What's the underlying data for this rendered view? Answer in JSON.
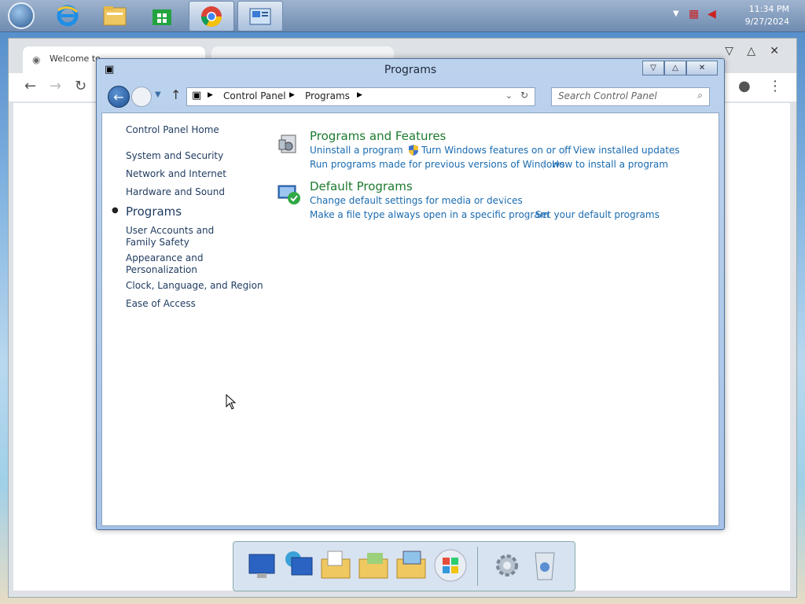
{
  "taskbar": {
    "clock_time": "11:34 PM",
    "clock_date": "9/27/2024",
    "apps": [
      "internet-explorer",
      "file-explorer",
      "windows-store",
      "chrome",
      "control-panel"
    ]
  },
  "chrome": {
    "tab1_title": "Welcome to"
  },
  "window": {
    "title": "Programs",
    "breadcrumb": [
      "Control Panel",
      "Programs"
    ],
    "search_placeholder": "Search Control Panel"
  },
  "left_nav": {
    "home": "Control Panel Home",
    "items": [
      "System and Security",
      "Network and Internet",
      "Hardware and Sound",
      "Programs",
      "User Accounts and Family Safety",
      "Appearance and Personalization",
      "Clock, Language, and Region",
      "Ease of Access"
    ],
    "current_index": 3
  },
  "categories": [
    {
      "title": "Programs and Features",
      "links": [
        "Uninstall a program",
        "Turn Windows features on or off",
        "View installed updates",
        "Run programs made for previous versions of Windows",
        "How to install a program"
      ]
    },
    {
      "title": "Default Programs",
      "links": [
        "Change default settings for media or devices",
        "Make a file type always open in a specific program",
        "Set your default programs"
      ]
    }
  ]
}
